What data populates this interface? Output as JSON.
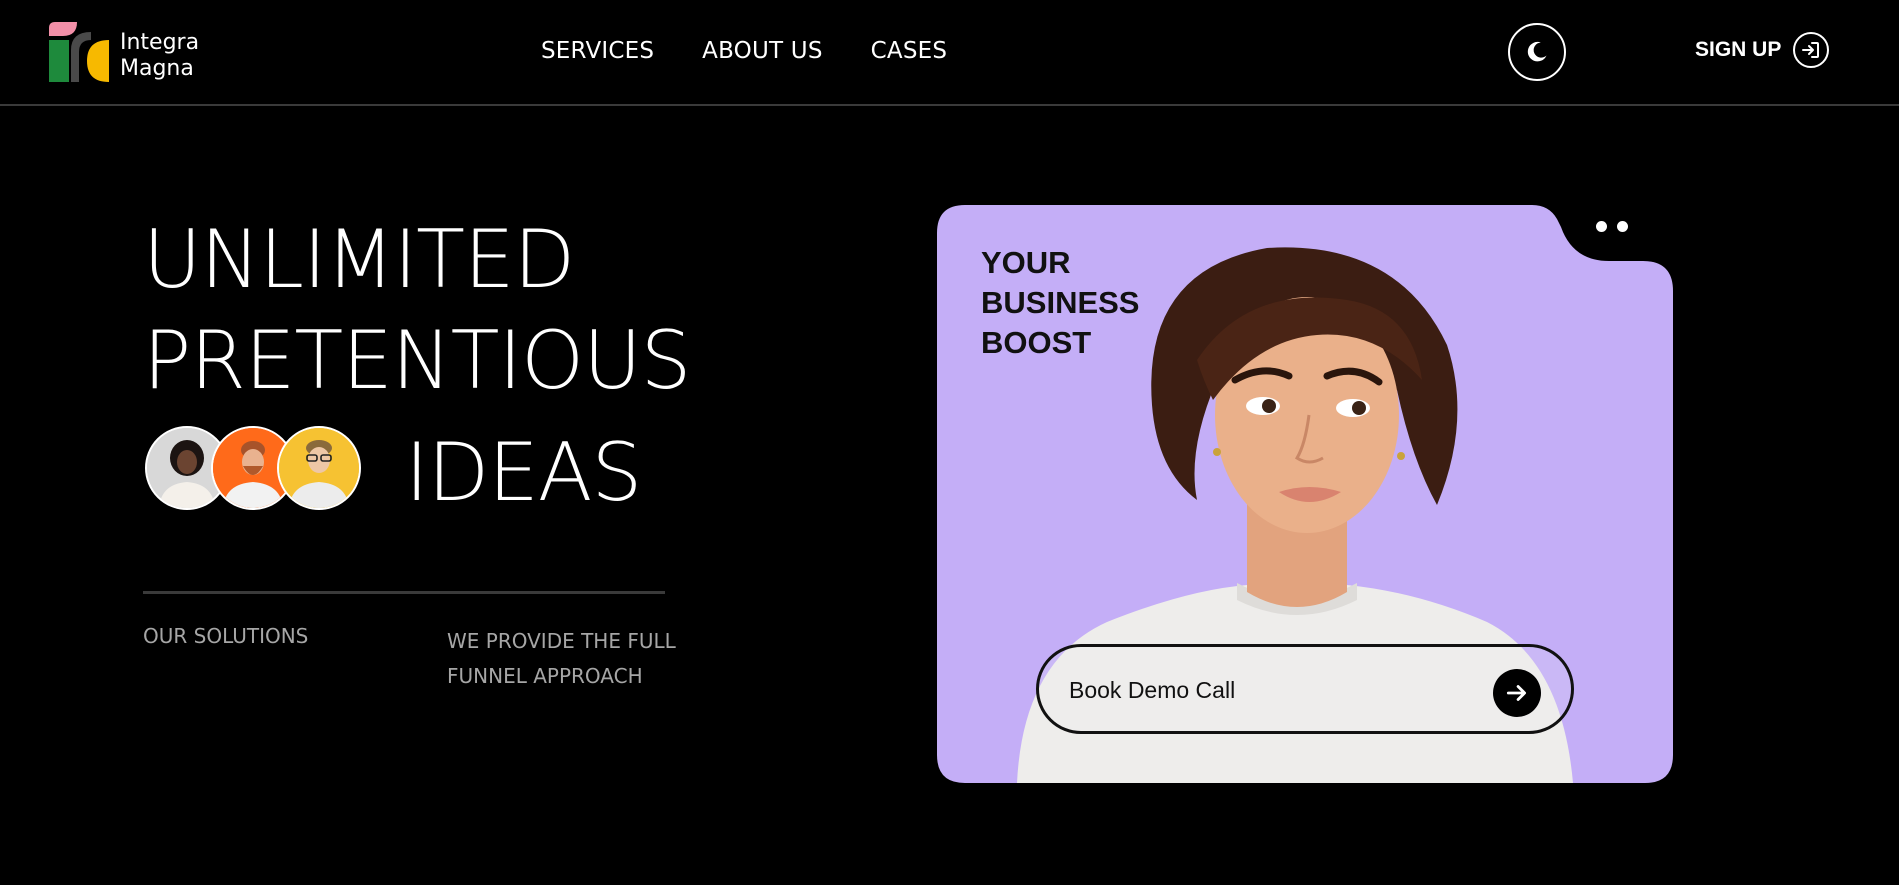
{
  "brand": {
    "name_line1": "Integra",
    "name_line2": "Magna",
    "colors": {
      "pink": "#f28fa8",
      "green": "#1e8a3c",
      "yellow": "#f7b900",
      "dark": "#4a4a4a"
    }
  },
  "nav": {
    "items": [
      {
        "label": "SERVICES"
      },
      {
        "label": "ABOUT US"
      },
      {
        "label": "CASES"
      }
    ]
  },
  "header": {
    "theme_toggle_icon": "moon-icon",
    "signup_label": "SIGN UP",
    "signup_icon": "sign-in-icon"
  },
  "hero": {
    "line1": "UNLIMITED",
    "line2": "PRETENTIOUS",
    "line3": "IDEAS",
    "avatar_colors": [
      "#d9d9d9",
      "#ff6a1a",
      "#f6c232"
    ],
    "sub_left": "OUR SOLUTIONS",
    "sub_right": "WE PROVIDE THE FULL FUNNEL APPROACH"
  },
  "card": {
    "title_line1": "YOUR",
    "title_line2": "BUSINESS",
    "title_line3": "BOOST",
    "background": "#c4aef7",
    "input_placeholder": "Book Demo Call",
    "submit_icon": "arrow-right-icon"
  }
}
